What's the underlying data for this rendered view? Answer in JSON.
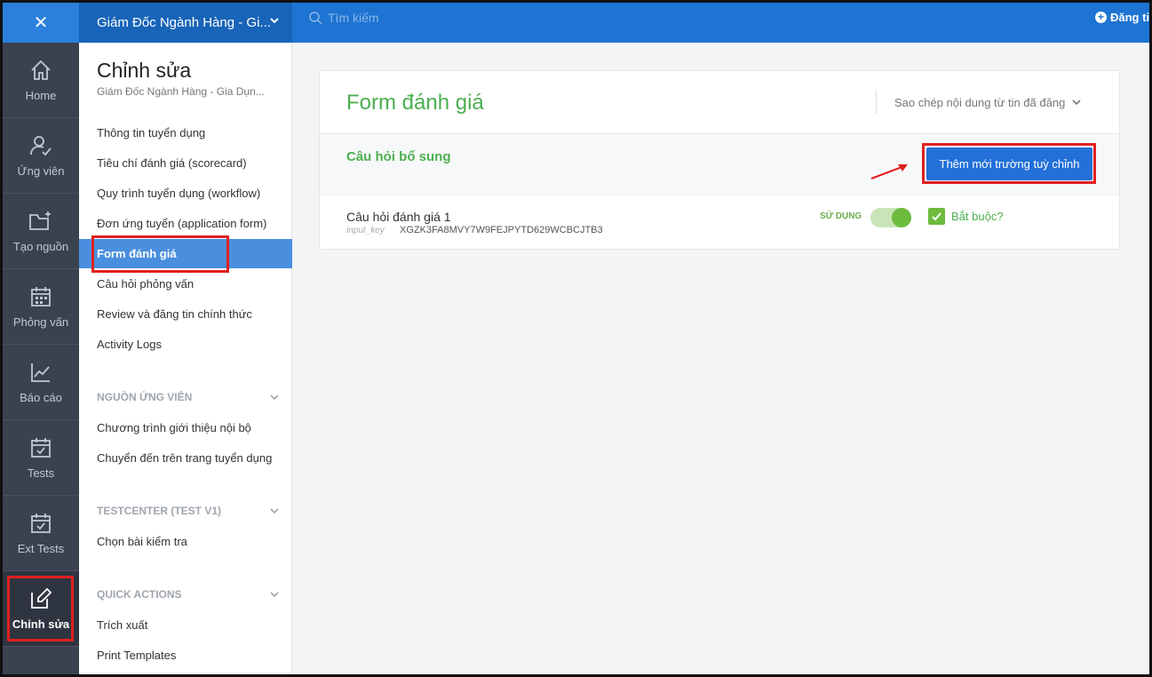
{
  "topbar": {
    "job_title": "Giám Đốc Ngành Hàng - Gi...",
    "search_placeholder": "Tìm kiếm",
    "post_label": "Đăng tin"
  },
  "rail": {
    "items": [
      {
        "label": "Home",
        "icon": "home-icon"
      },
      {
        "label": "Ứng viên",
        "icon": "candidate-icon"
      },
      {
        "label": "Tạo nguồn",
        "icon": "folder-plus-icon"
      },
      {
        "label": "Phỏng vấn",
        "icon": "calendar-icon"
      },
      {
        "label": "Báo cáo",
        "icon": "chart-line-icon"
      },
      {
        "label": "Tests",
        "icon": "test-calendar-icon"
      },
      {
        "label": "Ext Tests",
        "icon": "ext-test-calendar-icon"
      },
      {
        "label": "Chỉnh sửa",
        "icon": "edit-icon",
        "active": true
      }
    ]
  },
  "sidemenu": {
    "title": "Chỉnh sửa",
    "subtitle": "Giám Đốc Ngành Hàng - Gia Dụn...",
    "items": [
      "Thông tin tuyển dụng",
      "Tiêu chí đánh giá (scorecard)",
      "Quy trình tuyển dụng (workflow)",
      "Đơn ứng tuyển (application form)",
      "Form đánh giá",
      "Câu hỏi phỏng vấn",
      "Review và đăng tin chính thức",
      "Activity Logs"
    ],
    "active_index": 4,
    "sections": [
      {
        "title": "NGUỒN ỨNG VIÊN",
        "items": [
          "Chương trình giới thiệu nội bộ",
          "Chuyển đến trên trang tuyển dụng"
        ]
      },
      {
        "title": "TESTCENTER (TEST V1)",
        "items": [
          "Chọn bài kiểm tra"
        ]
      },
      {
        "title": "QUICK ACTIONS",
        "items": [
          "Trích xuất",
          "Print Templates"
        ]
      }
    ]
  },
  "main": {
    "title": "Form đánh giá",
    "copy_dropdown": "Sao chép nội dung từ tin đã đăng",
    "section_title": "Câu hỏi bổ sung",
    "add_button": "Thêm mới trường tuỳ chỉnh",
    "question": {
      "title": "Câu hỏi đánh giá 1",
      "key_label": "input_key",
      "key_value": "XGZK3FA8MVY7W9FEJPYTD629WCBCJTB3",
      "use_label": "SỬ DỤNG",
      "use_enabled": true,
      "required_label": "Bắt buộc?",
      "required_checked": true
    }
  },
  "colors": {
    "topbar": "#1e74d2",
    "rail": "#3a4250",
    "accent_green": "#4caf50",
    "button_blue": "#2270d8",
    "highlight_red": "#e02020"
  }
}
